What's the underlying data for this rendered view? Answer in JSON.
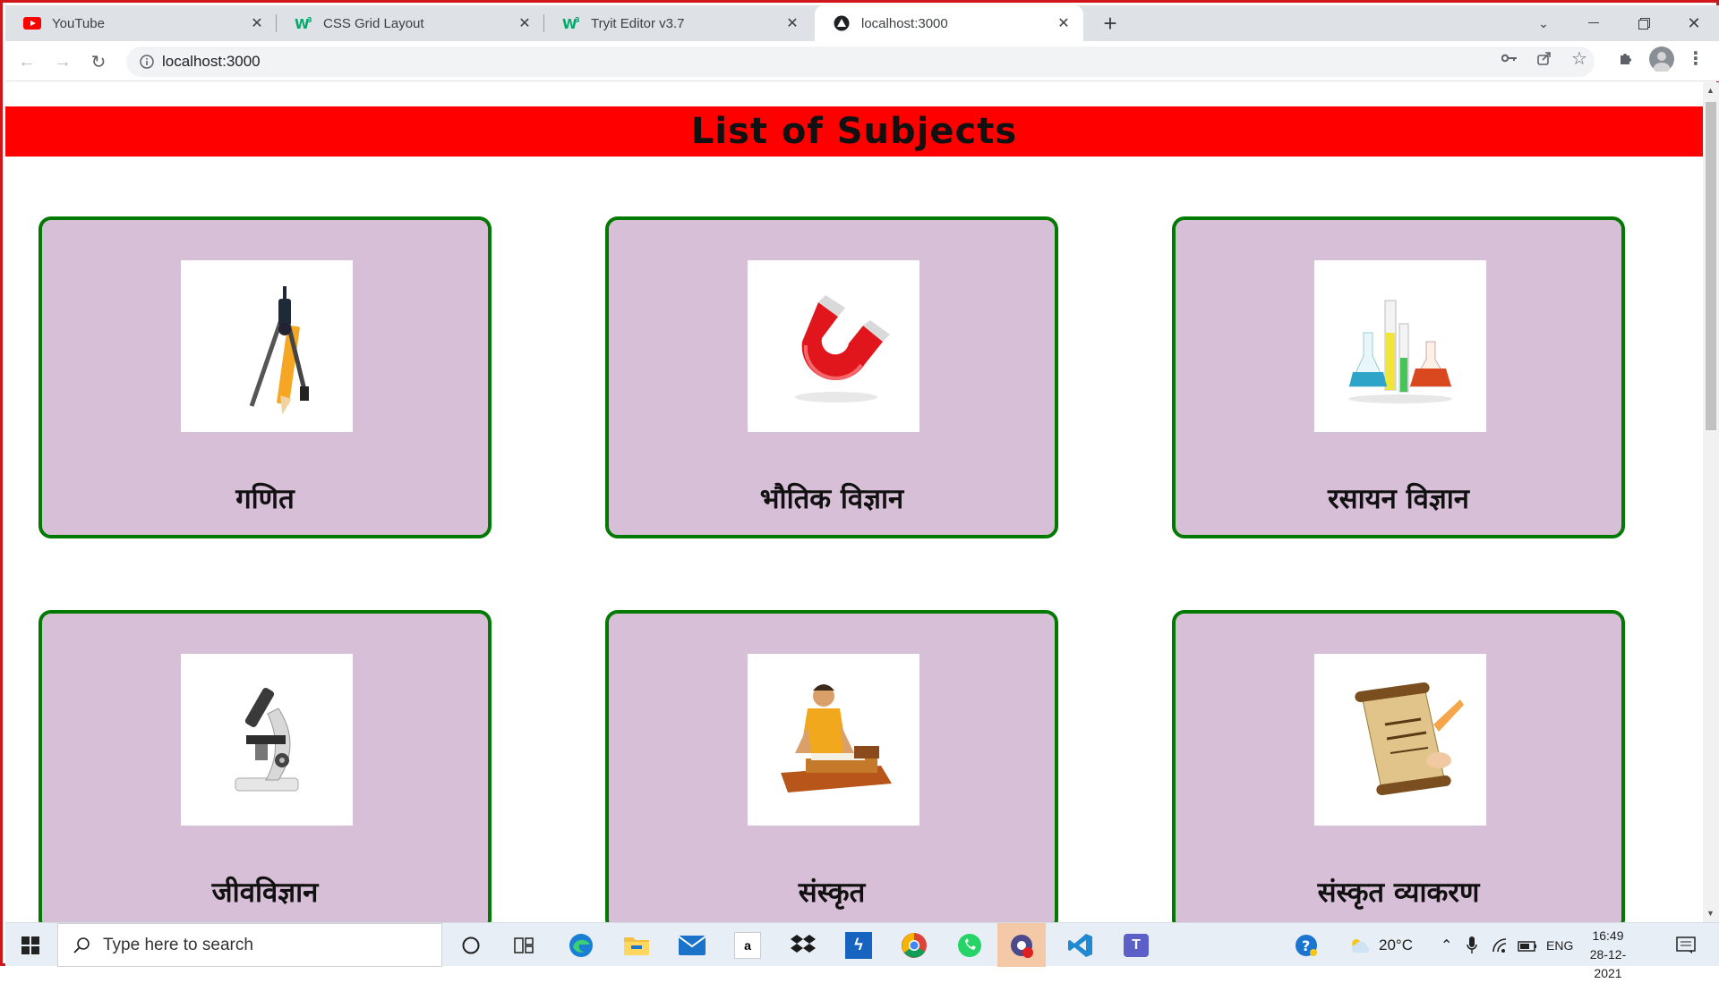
{
  "browser": {
    "tabs": [
      {
        "title": "YouTube",
        "icon": "youtube-icon",
        "active": false
      },
      {
        "title": "CSS Grid Layout",
        "icon": "w3schools-icon",
        "active": false
      },
      {
        "title": "Tryit Editor v3.7",
        "icon": "w3schools-icon",
        "active": false
      },
      {
        "title": "localhost:3000",
        "icon": "react-icon",
        "active": true
      }
    ],
    "url": "localhost:3000"
  },
  "page": {
    "heading": "List of Subjects",
    "colors": {
      "banner": "#ff0000",
      "card_bg": "#d8bfd8",
      "card_border": "#007a00"
    },
    "subjects": [
      {
        "name": "गणित",
        "image": "compass-pencil-icon"
      },
      {
        "name": "भौतिक विज्ञान",
        "image": "magnet-icon"
      },
      {
        "name": "रसायन विज्ञान",
        "image": "lab-flasks-icon"
      },
      {
        "name": "जीवविज्ञान",
        "image": "microscope-icon"
      },
      {
        "name": "संस्कृत",
        "image": "sanskrit-scholar-icon"
      },
      {
        "name": "संस्कृत व्याकरण",
        "image": "sanskrit-scroll-icon"
      }
    ]
  },
  "taskbar": {
    "search_placeholder": "Type here to search",
    "weather": "20°C",
    "language": "ENG",
    "time": "16:49",
    "date": "28-12-2021"
  }
}
